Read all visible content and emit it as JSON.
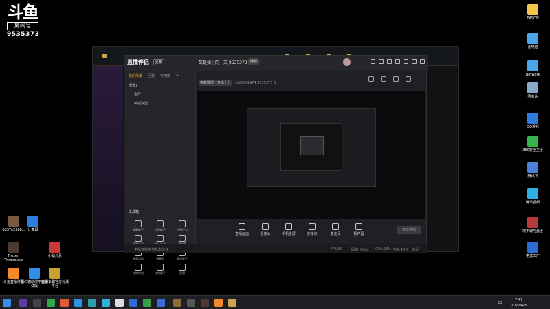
{
  "watermark": {
    "glyph": "斗鱼",
    "room_label": "房间号",
    "room_number": "9535373"
  },
  "desktop_right": [
    {
      "label": "EASON",
      "color": "#f4c54a"
    },
    {
      "label": "此电脑",
      "color": "#4aa6e8"
    },
    {
      "label": "Network",
      "color": "#4aa6e8"
    },
    {
      "label": "回收站",
      "color": "#8aa8c8"
    },
    {
      "label": "QQ游戏",
      "color": "#2f7be0"
    },
    {
      "label": "360安全卫士",
      "color": "#37b24d"
    },
    {
      "label": "腾讯飞",
      "color": "#4a82d8"
    },
    {
      "label": "腾讯视频",
      "color": "#2fb0e0"
    },
    {
      "label": "地下城与勇士",
      "color": "#b83a3a"
    },
    {
      "label": "格式工厂",
      "color": "#2f6bd6"
    }
  ],
  "desktop_left": [
    {
      "label": "6d37e2388...",
      "color": "#7a5a3a"
    },
    {
      "label": "计算器",
      "color": "#2f7be0"
    },
    {
      "label": "Frozen Throne.exe",
      "color": "#4a3a30"
    },
    {
      "label": "小助元素",
      "color": "#c83a3a"
    },
    {
      "label": "斗鱼直播伴侣",
      "color": "#f08a2a"
    },
    {
      "label": "新仁德动漫平台测试版",
      "color": "#2f8ee8"
    },
    {
      "label": "魔兽争霸官方对战平台",
      "color": "#c8a030"
    }
  ],
  "app": {
    "logo": "直播伴侣",
    "logo_badge": "更新",
    "room_title": "又是掉分的一天 9535373",
    "edit_label": "编辑",
    "category": "英雄联盟 · 开始上分",
    "streamer": "EASON1974",
    "room_id": "9535373",
    "viewers": "0",
    "tabs": [
      "我的场景",
      "回放",
      "可用库",
      "+"
    ],
    "scenes": [
      {
        "label": "场景1",
        "sub": false
      },
      {
        "label": "全屏1",
        "sub": true
      },
      {
        "label": "英雄联盟",
        "sub": true
      }
    ],
    "tools_heading": "工具箱",
    "tools": [
      "弹幕助手",
      "房管助手",
      "主播任务",
      "视频连麦",
      "多人连麦",
      "超弹幕",
      "福利活动",
      "弹幕墙",
      "歌词助手",
      "礼物特效",
      "红包助手",
      "竞猜"
    ],
    "bottom_tools": [
      "直播画面",
      "摄像头",
      "手机投屏",
      "多媒体",
      "麦克风",
      "扬声器"
    ],
    "start_label": "开始直播",
    "status": {
      "left": "主播直播中信息未验证",
      "fps": "FPS:60",
      "bitrate": "码率:0Kb/s",
      "cpu": "CPU:13%",
      "mem": "内存:46%",
      "delay": "延迟"
    }
  },
  "taskbar": {
    "time": "7:47",
    "date": "2022/4/3",
    "tray_text": "中"
  }
}
